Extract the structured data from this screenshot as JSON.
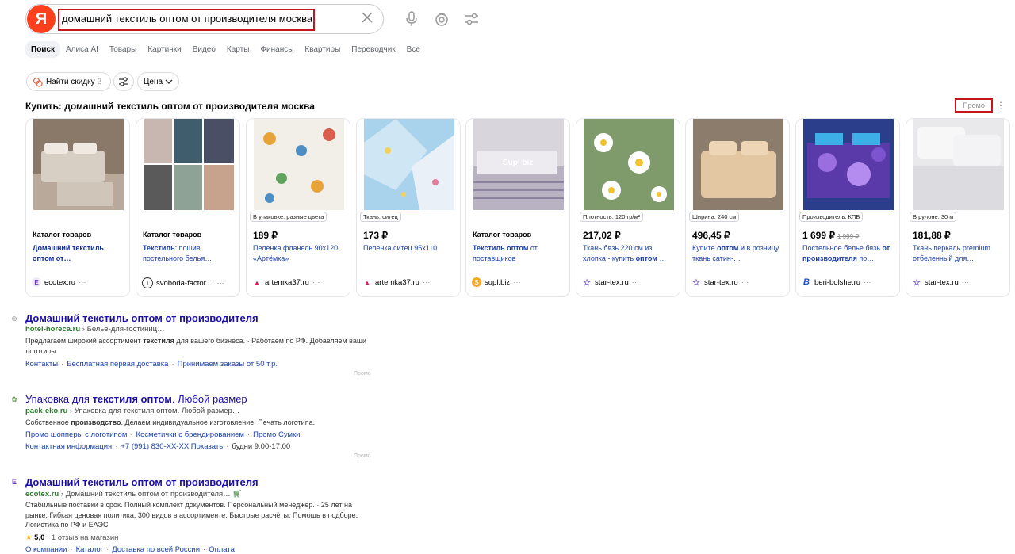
{
  "search": {
    "logo": "Я",
    "query": "домашний текстиль оптом от производителя москва"
  },
  "tabs": [
    "Поиск",
    "Алиса AI",
    "Товары",
    "Картинки",
    "Видео",
    "Карты",
    "Финансы",
    "Квартиры",
    "Переводчик",
    "Все"
  ],
  "filters": {
    "discount": "Найти скидку",
    "discount_beta": "β",
    "price": "Цена"
  },
  "shopping": {
    "title": "Купить: домашний текстиль оптом от производителя москва",
    "promo": "Промо",
    "cards": [
      {
        "head": "Каталог товаров",
        "desc": "Домашний текстиль оптом от…",
        "source": "ecotex.ru",
        "fav": "E"
      },
      {
        "head": "Каталог товаров",
        "desc": "Текстиль: пошив постельного белья…",
        "source": "svoboda-factor…",
        "fav": "T"
      },
      {
        "tag": "В упаковке: разные цвета",
        "price": "189 ₽",
        "desc": "Пеленка фланель 90x120 «Артёмка»",
        "source": "artemka37.ru",
        "fav": "A"
      },
      {
        "tag": "Ткань: ситец",
        "price": "173 ₽",
        "desc": "Пеленка ситец 95x110",
        "source": "artemka37.ru",
        "fav": "A"
      },
      {
        "head": "Каталог товаров",
        "desc": "Текстиль оптом от поставщиков",
        "source": "supl.biz",
        "fav": "S",
        "watermark": "Supl biz"
      },
      {
        "tag": "Плотность: 120 гр/м²",
        "price": "217,02 ₽",
        "desc": "Ткань бязь 220 см из хлопка - купить оптом …",
        "source": "star-tex.ru",
        "fav": "★"
      },
      {
        "tag": "Ширина: 240 см",
        "price": "496,45 ₽",
        "desc": "Купите оптом и в розницу ткань сатин-…",
        "source": "star-tex.ru",
        "fav": "★"
      },
      {
        "tag": "Производитель: КПБ",
        "price": "1 699 ₽",
        "old_price": "1 999 ₽",
        "desc": "Постельное белье бязь от производителя по…",
        "source": "beri-bolshe.ru",
        "fav": "B"
      },
      {
        "tag": "В рулоне: 30 м",
        "price": "181,88 ₽",
        "desc": "Ткань перкаль premium отбеленный для…",
        "source": "star-tex.ru",
        "fav": "★"
      }
    ]
  },
  "results": [
    {
      "title": "Домашний текстиль оптом от производителя",
      "domain": "hotel-horeca.ru",
      "path": "› Белье-для-гостиниц…",
      "text": "Предлагаем широкий ассортимент текстиля для вашего бизнеса. · Работаем по РФ. Добавляем ваши логотипы",
      "links": [
        "Контакты",
        "Бесплатная первая доставка",
        "Принимаем заказы от 50 т.р."
      ],
      "promo": "Промо"
    },
    {
      "title": "Упаковка для текстиля оптом. Любой размер",
      "domain": "pack-eko.ru",
      "path": "› Упаковка для текстиля оптом. Любой размер…",
      "text": "Собственное производство. Делаем индивидуальное изготовление. Печать логотипа.",
      "links": [
        "Промо шопперы с логотипом",
        "Косметички с брендированием",
        "Промо Сумки"
      ],
      "links2": [
        "Контактная информация",
        "+7 (991) 830-XX-XX Показать",
        "будни 9:00-17:00"
      ],
      "promo": "Промо"
    },
    {
      "title": "Домашний текстиль оптом от производителя",
      "domain": "ecotex.ru",
      "path": "› Домашний текстиль оптом от производителя…",
      "text": "Стабильные поставки в срок. Полный комплект документов. Персональный менеджер. · 25 лет на рынке. Гибкая ценовая политика. 300 видов в ассортименте. Быстрые расчёты. Помощь в подборе. Логистика по РФ и ЕАЭС",
      "rating": "5,0",
      "reviews": "· 1 отзыв на магазин",
      "links": [
        "О компании",
        "Каталог",
        "Доставка по всей России",
        "Оплата"
      ]
    }
  ]
}
